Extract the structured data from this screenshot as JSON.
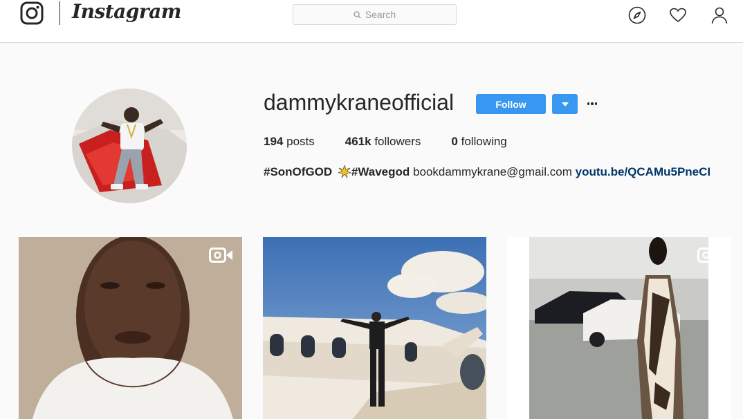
{
  "nav": {
    "wordmark": "Instagram",
    "search_placeholder": "Search",
    "icons": [
      "instagram-glyph-icon",
      "compass-icon",
      "heart-icon",
      "user-icon"
    ]
  },
  "profile": {
    "username": "dammykraneofficial",
    "follow_label": "Follow",
    "stats": {
      "posts_count": "194",
      "posts_label": "posts",
      "followers_count": "461k",
      "followers_label": "followers",
      "following_count": "0",
      "following_label": "following"
    },
    "bio": {
      "tag1": "#SonOfGOD",
      "tag2": "#Wavegod",
      "email": "bookdammykrane@gmail.com",
      "link": "youtu.be/QCAMu5PneCI"
    }
  },
  "posts": [
    {
      "type": "video"
    },
    {
      "type": "image"
    },
    {
      "type": "video"
    }
  ],
  "colors": {
    "accent": "#3897f0",
    "link": "#003569",
    "background": "#fafafa",
    "border": "#dbdbdb"
  }
}
